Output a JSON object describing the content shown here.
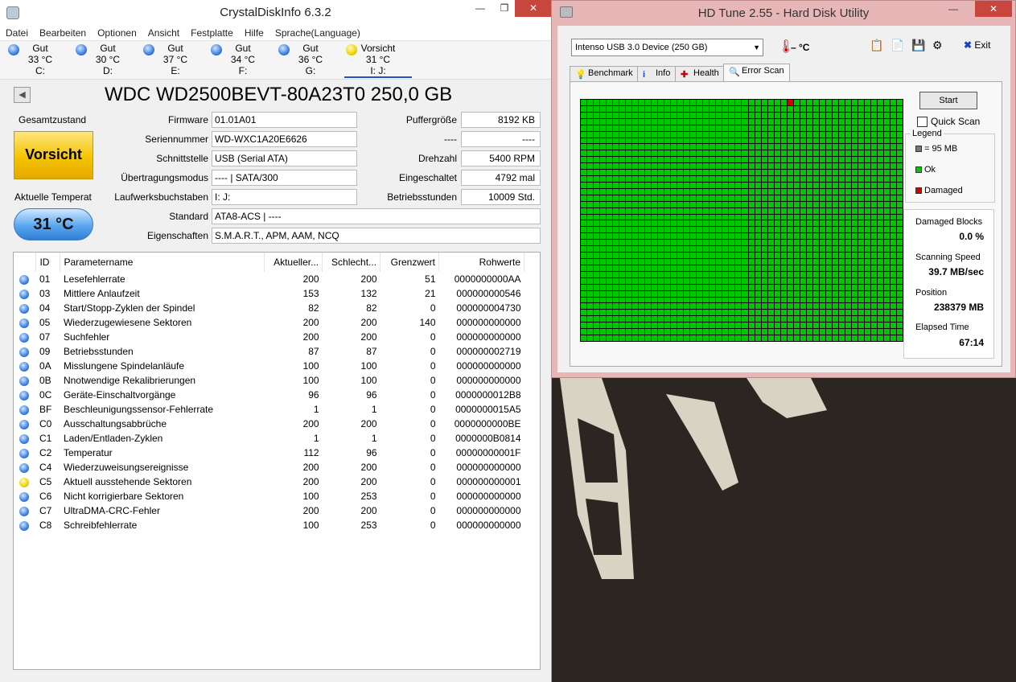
{
  "crystal": {
    "title": "CrystalDiskInfo 6.3.2",
    "menu": [
      "Datei",
      "Bearbeiten",
      "Optionen",
      "Ansicht",
      "Festplatte",
      "Hilfe",
      "Sprache(Language)"
    ],
    "drives": [
      {
        "status": "Gut",
        "temp": "33 °C",
        "letter": "C:",
        "color": "blue"
      },
      {
        "status": "Gut",
        "temp": "30 °C",
        "letter": "D:",
        "color": "blue"
      },
      {
        "status": "Gut",
        "temp": "37 °C",
        "letter": "E:",
        "color": "blue"
      },
      {
        "status": "Gut",
        "temp": "34 °C",
        "letter": "F:",
        "color": "blue"
      },
      {
        "status": "Gut",
        "temp": "36 °C",
        "letter": "G:",
        "color": "blue"
      },
      {
        "status": "Vorsicht",
        "temp": "31 °C",
        "letter": "I: J:",
        "color": "yellow"
      }
    ],
    "model": "WDC WD2500BEVT-80A23T0 250,0 GB",
    "health_label": "Gesamtzustand",
    "health_value": "Vorsicht",
    "temp_label": "Aktuelle Temperat",
    "temp_value": "31 °C",
    "info": {
      "firmware_label": "Firmware",
      "firmware": "01.01A01",
      "serial_label": "Seriennummer",
      "serial": "WD-WXC1A20E6626",
      "interface_label": "Schnittstelle",
      "interface": "USB (Serial ATA)",
      "transfer_label": "Übertragungsmodus",
      "transfer": "---- | SATA/300",
      "letters_label": "Laufwerksbuchstaben",
      "letters": "I: J:",
      "standard_label": "Standard",
      "standard": "ATA8-ACS | ----",
      "features_label": "Eigenschaften",
      "features": "S.M.A.R.T., APM, AAM, NCQ",
      "buffer_label": "Puffergröße",
      "buffer": "8192 KB",
      "nv_label": "----",
      "nv": "----",
      "rpm_label": "Drehzahl",
      "rpm": "5400 RPM",
      "poweron_label": "Eingeschaltet",
      "poweron": "4792 mal",
      "hours_label": "Betriebsstunden",
      "hours": "10009 Std."
    },
    "smart_headers": [
      "ID",
      "Parametername",
      "Aktueller...",
      "Schlecht...",
      "Grenzwert",
      "Rohwerte"
    ],
    "smart_rows": [
      {
        "id": "01",
        "name": "Lesefehlerrate",
        "cur": "200",
        "worst": "200",
        "thr": "51",
        "raw": "0000000000AA",
        "color": "blue"
      },
      {
        "id": "03",
        "name": "Mittlere Anlaufzeit",
        "cur": "153",
        "worst": "132",
        "thr": "21",
        "raw": "000000000546",
        "color": "blue"
      },
      {
        "id": "04",
        "name": "Start/Stopp-Zyklen der Spindel",
        "cur": "82",
        "worst": "82",
        "thr": "0",
        "raw": "000000004730",
        "color": "blue"
      },
      {
        "id": "05",
        "name": "Wiederzugewiesene Sektoren",
        "cur": "200",
        "worst": "200",
        "thr": "140",
        "raw": "000000000000",
        "color": "blue"
      },
      {
        "id": "07",
        "name": "Suchfehler",
        "cur": "200",
        "worst": "200",
        "thr": "0",
        "raw": "000000000000",
        "color": "blue"
      },
      {
        "id": "09",
        "name": "Betriebsstunden",
        "cur": "87",
        "worst": "87",
        "thr": "0",
        "raw": "000000002719",
        "color": "blue"
      },
      {
        "id": "0A",
        "name": "Misslungene Spindelanläufe",
        "cur": "100",
        "worst": "100",
        "thr": "0",
        "raw": "000000000000",
        "color": "blue"
      },
      {
        "id": "0B",
        "name": "Nnotwendige Rekalibrierungen",
        "cur": "100",
        "worst": "100",
        "thr": "0",
        "raw": "000000000000",
        "color": "blue"
      },
      {
        "id": "0C",
        "name": "Geräte-Einschaltvorgänge",
        "cur": "96",
        "worst": "96",
        "thr": "0",
        "raw": "0000000012B8",
        "color": "blue"
      },
      {
        "id": "BF",
        "name": "Beschleunigungssensor-Fehlerrate",
        "cur": "1",
        "worst": "1",
        "thr": "0",
        "raw": "0000000015A5",
        "color": "blue"
      },
      {
        "id": "C0",
        "name": "Ausschaltungsabbrüche",
        "cur": "200",
        "worst": "200",
        "thr": "0",
        "raw": "0000000000BE",
        "color": "blue"
      },
      {
        "id": "C1",
        "name": "Laden/Entladen-Zyklen",
        "cur": "1",
        "worst": "1",
        "thr": "0",
        "raw": "0000000B0814",
        "color": "blue"
      },
      {
        "id": "C2",
        "name": "Temperatur",
        "cur": "112",
        "worst": "96",
        "thr": "0",
        "raw": "00000000001F",
        "color": "blue"
      },
      {
        "id": "C4",
        "name": "Wiederzuweisungsereignisse",
        "cur": "200",
        "worst": "200",
        "thr": "0",
        "raw": "000000000000",
        "color": "blue"
      },
      {
        "id": "C5",
        "name": "Aktuell ausstehende Sektoren",
        "cur": "200",
        "worst": "200",
        "thr": "0",
        "raw": "000000000001",
        "color": "yellow"
      },
      {
        "id": "C6",
        "name": "Nicht korrigierbare Sektoren",
        "cur": "100",
        "worst": "253",
        "thr": "0",
        "raw": "000000000000",
        "color": "blue"
      },
      {
        "id": "C7",
        "name": "UltraDMA-CRC-Fehler",
        "cur": "200",
        "worst": "200",
        "thr": "0",
        "raw": "000000000000",
        "color": "blue"
      },
      {
        "id": "C8",
        "name": "Schreibfehlerrate",
        "cur": "100",
        "worst": "253",
        "thr": "0",
        "raw": "000000000000",
        "color": "blue"
      }
    ]
  },
  "hdtune": {
    "title": "HD Tune 2.55 - Hard Disk Utility",
    "device": "Intenso USB 3.0 Device (250 GB)",
    "temp": "– °C",
    "exit_label": "Exit",
    "tabs": [
      "Benchmark",
      "Info",
      "Health",
      "Error Scan"
    ],
    "start_label": "Start",
    "quick_scan_label": "Quick Scan",
    "legend_title": "Legend",
    "legend_block": "= 95 MB",
    "legend_ok": "Ok",
    "legend_damaged": "Damaged",
    "damaged_blocks_label": "Damaged Blocks",
    "damaged_blocks": "0.0 %",
    "speed_label": "Scanning Speed",
    "speed": "39.7 MB/sec",
    "position_label": "Position",
    "position": "238379 MB",
    "elapsed_label": "Elapsed Time",
    "elapsed": "67:14",
    "scan_grid": {
      "columns": 50,
      "rows": 38,
      "damaged_cells": [
        {
          "row": 0,
          "col": 32
        }
      ]
    },
    "colors": {
      "ok": "#00c800",
      "damaged": "#d40000"
    }
  }
}
